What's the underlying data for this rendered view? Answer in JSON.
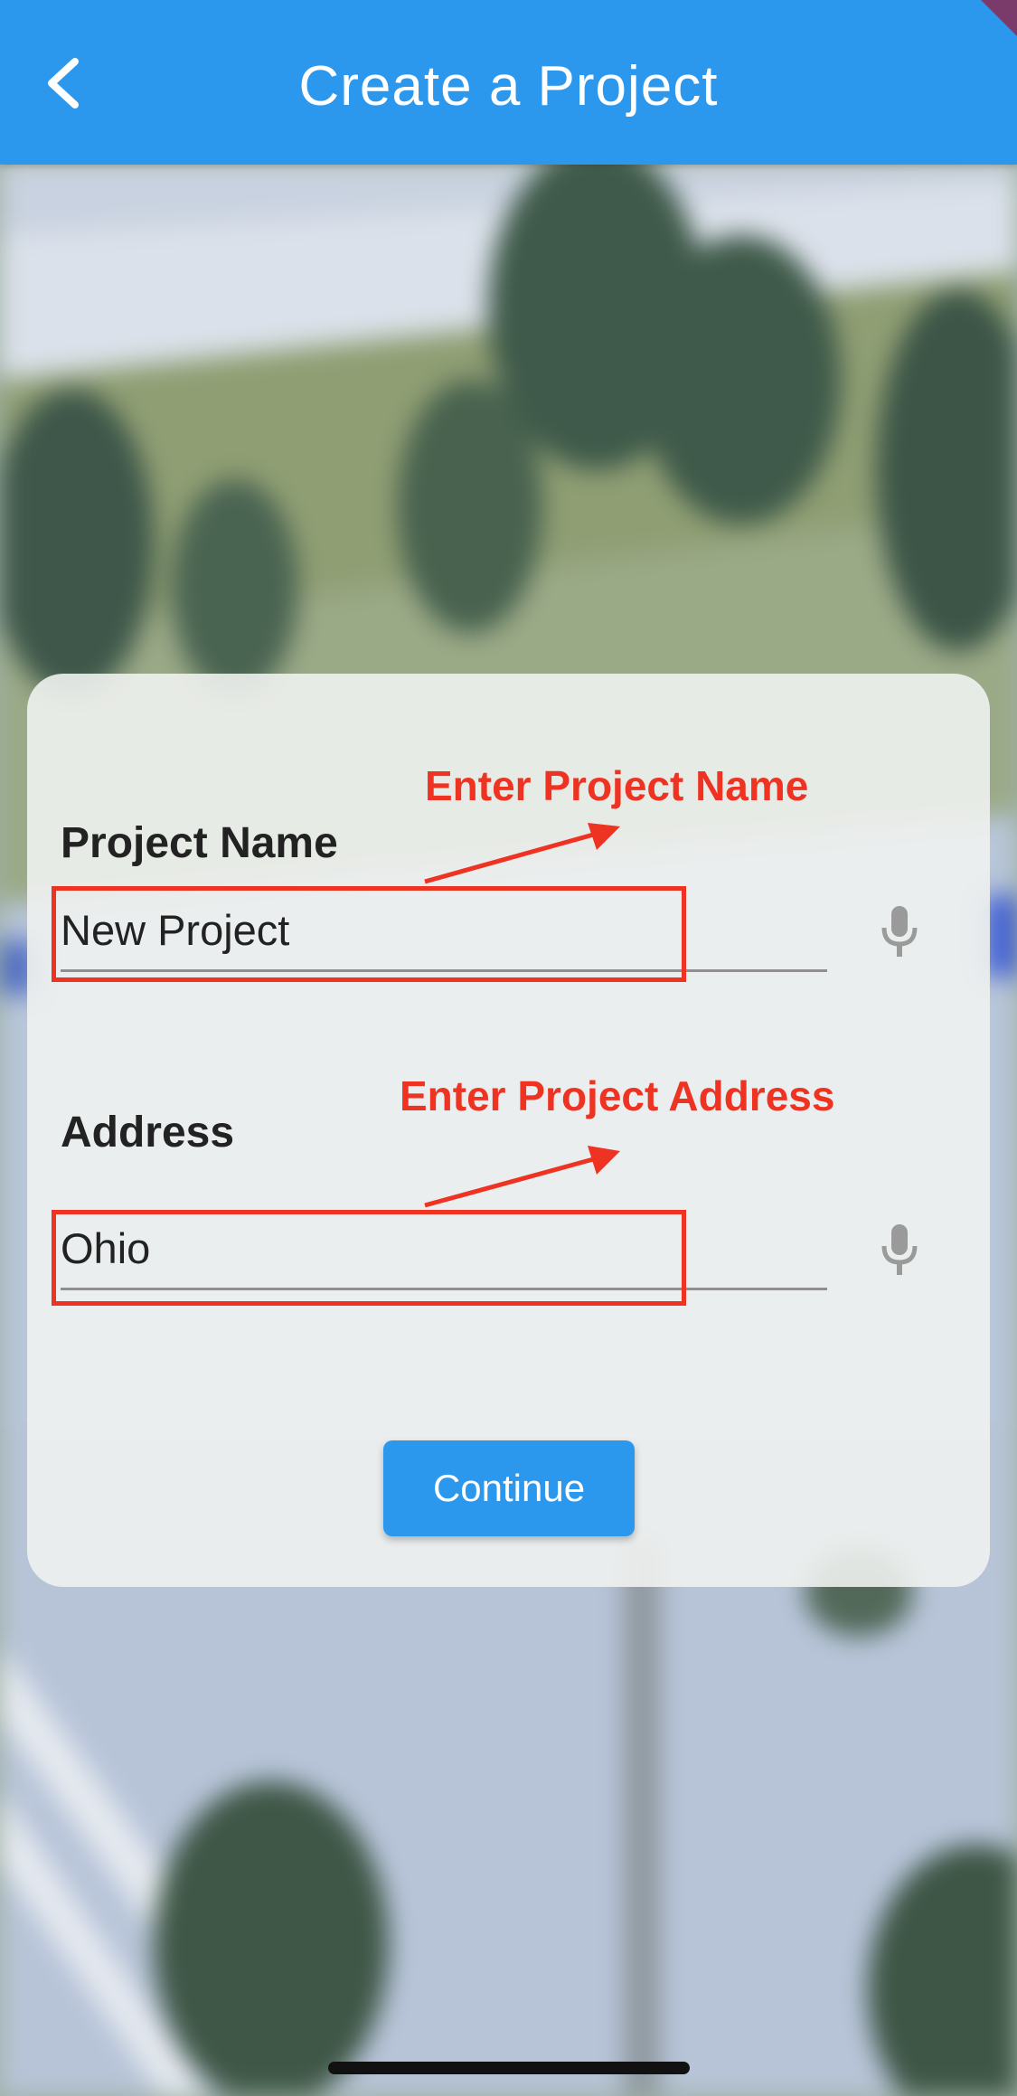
{
  "appbar": {
    "title": "Create a Project",
    "back_icon": "chevron-left-icon",
    "color": "#2b98ee"
  },
  "form": {
    "project_name": {
      "label": "Project Name",
      "value": "New Project",
      "mic_icon": "microphone-icon"
    },
    "address": {
      "label": "Address",
      "value": "Ohio",
      "mic_icon": "microphone-icon"
    },
    "continue_label": "Continue"
  },
  "annotations": {
    "name_hint": "Enter Project Name",
    "address_hint": "Enter Project Address",
    "color": "#ee3322"
  }
}
